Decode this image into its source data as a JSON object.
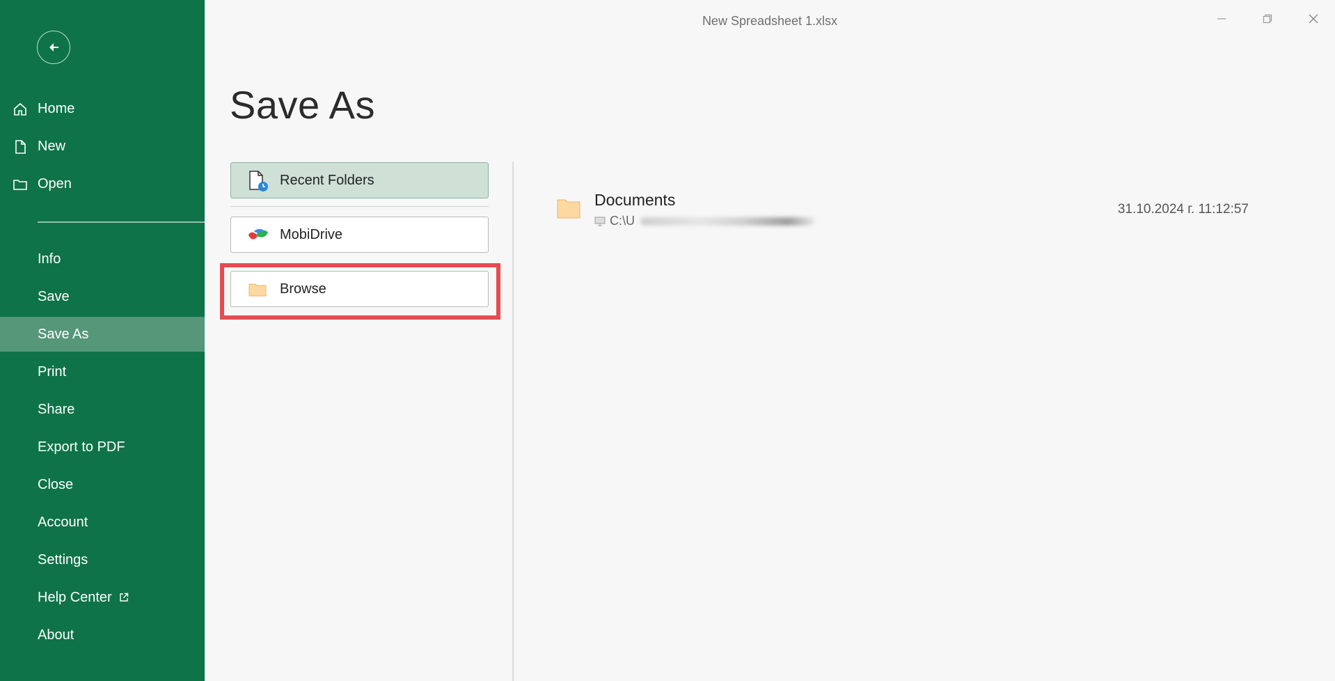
{
  "window": {
    "title": "New Spreadsheet 1.xlsx"
  },
  "sidebar": {
    "top_items": [
      {
        "label": "Home",
        "icon": "home-icon"
      },
      {
        "label": "New",
        "icon": "new-file-icon"
      },
      {
        "label": "Open",
        "icon": "open-folder-icon"
      }
    ],
    "items": [
      {
        "label": "Info"
      },
      {
        "label": "Save"
      },
      {
        "label": "Save As",
        "active": true
      },
      {
        "label": "Print"
      },
      {
        "label": "Share"
      },
      {
        "label": "Export to PDF"
      },
      {
        "label": "Close"
      },
      {
        "label": "Account"
      },
      {
        "label": "Settings"
      },
      {
        "label": "Help Center",
        "external": true
      },
      {
        "label": "About"
      }
    ]
  },
  "main": {
    "heading": "Save As",
    "locations": [
      {
        "label": "Recent Folders",
        "icon": "recent-folders-icon",
        "selected": true
      },
      {
        "label": "MobiDrive",
        "icon": "mobidrive-icon"
      },
      {
        "label": "Browse",
        "icon": "folder-icon",
        "highlighted": true
      }
    ],
    "recent": [
      {
        "name": "Documents",
        "path_visible": "C:\\U",
        "date": "31.10.2024 г. 11:12:57"
      }
    ]
  },
  "colors": {
    "sidebar_bg": "#0e7348",
    "sidebar_active": "#56977a",
    "selected_location": "#cfe0d7",
    "highlight_border": "#e64b4f",
    "folder": "#fcd9a0"
  }
}
